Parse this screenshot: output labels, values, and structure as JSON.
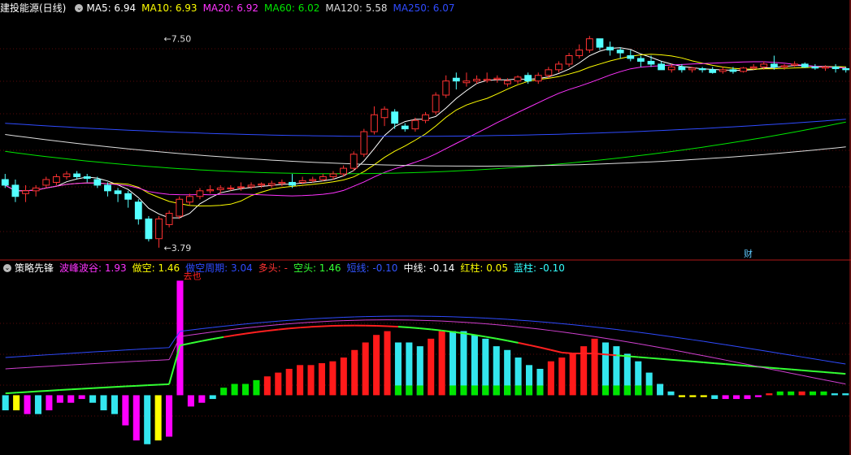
{
  "top_legend": {
    "stock": "建投能源(日线)",
    "ma5": "MA5: 6.94",
    "ma10": "MA10: 6.93",
    "ma20": "MA20: 6.92",
    "ma60": "MA60: 6.02",
    "ma120": "MA120: 5.58",
    "ma250": "MA250: 6.07",
    "colors": {
      "ma5": "#ffffff",
      "ma10": "#ffff00",
      "ma20": "#ff33ff",
      "ma60": "#00e600",
      "ma120": "#dddddd",
      "ma250": "#2f4bff"
    }
  },
  "bottom_legend": {
    "name": "策略先锋",
    "bofeng": "波峰波谷: 1.93",
    "zuokong": "做空: 1.46",
    "zuokong_period": "做空周期: 3.04",
    "duotou": "多头: -",
    "kongtou": "空头: 1.46",
    "duanxian": "短线: -0.10",
    "zhongxian": "中线: -0.14",
    "hongzhu": "红柱: 0.05",
    "lanzhu": "蓝柱: -0.10"
  },
  "cai_label": "财",
  "chart_data": [
    {
      "type": "candlestick",
      "title": "建投能源(日线)",
      "ylim": [
        3.6,
        7.9
      ],
      "annotations": [
        {
          "text": "7.50",
          "value": 7.5
        },
        {
          "text": "3.79",
          "value": 3.79
        }
      ],
      "candles": [
        [
          5.0,
          4.9,
          5.1,
          4.85
        ],
        [
          4.9,
          4.7,
          5.0,
          4.6
        ],
        [
          4.75,
          4.8,
          4.9,
          4.6
        ],
        [
          4.8,
          4.85,
          4.9,
          4.7
        ],
        [
          4.9,
          5.0,
          5.05,
          4.85
        ],
        [
          4.95,
          5.05,
          5.1,
          4.9
        ],
        [
          5.05,
          5.1,
          5.15,
          5.0
        ],
        [
          5.1,
          5.05,
          5.15,
          5.0
        ],
        [
          5.05,
          5.02,
          5.1,
          4.95
        ],
        [
          5.0,
          4.9,
          5.05,
          4.85
        ],
        [
          4.9,
          4.8,
          4.95,
          4.7
        ],
        [
          4.8,
          4.75,
          4.85,
          4.6
        ],
        [
          4.75,
          4.65,
          4.8,
          4.5
        ],
        [
          4.6,
          4.3,
          4.65,
          4.2
        ],
        [
          4.3,
          3.95,
          4.35,
          3.9
        ],
        [
          3.95,
          4.3,
          4.35,
          3.79
        ],
        [
          4.2,
          4.4,
          4.45,
          4.15
        ],
        [
          4.35,
          4.65,
          4.7,
          4.3
        ],
        [
          4.6,
          4.7,
          4.75,
          4.55
        ],
        [
          4.7,
          4.8,
          4.85,
          4.65
        ],
        [
          4.8,
          4.82,
          4.9,
          4.75
        ],
        [
          4.82,
          4.85,
          4.9,
          4.75
        ],
        [
          4.85,
          4.85,
          4.9,
          4.8
        ],
        [
          4.86,
          4.87,
          4.95,
          4.8
        ],
        [
          4.87,
          4.9,
          4.95,
          4.83
        ],
        [
          4.9,
          4.92,
          4.95,
          4.85
        ],
        [
          4.9,
          4.93,
          4.98,
          4.85
        ],
        [
          4.93,
          4.95,
          5.0,
          4.88
        ],
        [
          4.95,
          4.9,
          5.1,
          4.85
        ],
        [
          4.95,
          4.98,
          5.05,
          4.92
        ],
        [
          4.98,
          5.0,
          5.05,
          4.95
        ],
        [
          5.0,
          5.05,
          5.1,
          4.97
        ],
        [
          5.05,
          5.1,
          5.15,
          5.0
        ],
        [
          5.1,
          5.2,
          5.25,
          5.05
        ],
        [
          5.2,
          5.45,
          5.5,
          5.15
        ],
        [
          5.45,
          5.85,
          5.9,
          5.4
        ],
        [
          5.85,
          6.15,
          6.3,
          5.8
        ],
        [
          6.1,
          6.25,
          6.3,
          5.95
        ],
        [
          6.2,
          6.0,
          6.25,
          5.9
        ],
        [
          5.95,
          5.9,
          6.0,
          5.85
        ],
        [
          5.9,
          6.05,
          6.1,
          5.85
        ],
        [
          6.05,
          6.15,
          6.2,
          6.0
        ],
        [
          6.2,
          6.5,
          6.55,
          6.15
        ],
        [
          6.5,
          6.75,
          6.85,
          6.45
        ],
        [
          6.8,
          6.75,
          6.9,
          6.6
        ],
        [
          6.72,
          6.75,
          6.9,
          6.65
        ],
        [
          6.75,
          6.78,
          6.85,
          6.7
        ],
        [
          6.76,
          6.78,
          6.9,
          6.72
        ],
        [
          6.78,
          6.8,
          6.85,
          6.72
        ],
        [
          6.7,
          6.75,
          6.8,
          6.65
        ],
        [
          6.75,
          6.82,
          6.85,
          6.7
        ],
        [
          6.85,
          6.75,
          6.9,
          6.7
        ],
        [
          6.75,
          6.85,
          6.9,
          6.7
        ],
        [
          6.85,
          6.95,
          7.0,
          6.8
        ],
        [
          6.95,
          7.05,
          7.1,
          6.9
        ],
        [
          7.05,
          7.2,
          7.25,
          7.0
        ],
        [
          7.2,
          7.3,
          7.4,
          7.15
        ],
        [
          7.3,
          7.5,
          7.55,
          7.25
        ],
        [
          7.5,
          7.35,
          7.5,
          7.3
        ],
        [
          7.35,
          7.3,
          7.45,
          7.2
        ],
        [
          7.3,
          7.25,
          7.35,
          7.15
        ],
        [
          7.2,
          7.15,
          7.3,
          7.1
        ],
        [
          7.15,
          7.1,
          7.2,
          7.0
        ],
        [
          7.1,
          7.05,
          7.2,
          7.0
        ],
        [
          7.05,
          6.95,
          7.1,
          6.95
        ],
        [
          6.95,
          7.0,
          7.05,
          6.9
        ],
        [
          7.0,
          6.95,
          7.05,
          6.9
        ],
        [
          6.95,
          6.98,
          7.0,
          6.9
        ],
        [
          6.97,
          6.95,
          7.0,
          6.9
        ],
        [
          6.95,
          6.9,
          7.0,
          6.88
        ],
        [
          6.92,
          6.95,
          7.0,
          6.88
        ],
        [
          6.95,
          6.92,
          7.0,
          6.88
        ],
        [
          6.92,
          6.98,
          7.0,
          6.9
        ],
        [
          6.98,
          7.0,
          7.05,
          6.95
        ],
        [
          7.0,
          7.05,
          7.1,
          6.95
        ],
        [
          7.05,
          7.0,
          7.2,
          6.95
        ],
        [
          7.0,
          7.02,
          7.05,
          6.95
        ],
        [
          7.03,
          7.05,
          7.1,
          7.0
        ],
        [
          7.05,
          7.0,
          7.08,
          6.98
        ],
        [
          7.0,
          6.98,
          7.05,
          6.95
        ],
        [
          6.98,
          7.0,
          7.03,
          6.93
        ],
        [
          7.0,
          6.97,
          7.05,
          6.9
        ],
        [
          6.97,
          6.95,
          7.0,
          6.9
        ]
      ]
    },
    {
      "type": "bar",
      "title": "策略先锋",
      "ylim": [
        -1.5,
        3.2
      ],
      "annotations": [
        {
          "text": "去也",
          "index": 16
        }
      ],
      "histogram": [
        [
          -0.4,
          "cyan"
        ],
        [
          -0.4,
          "yellow"
        ],
        [
          -0.5,
          "magenta"
        ],
        [
          -0.5,
          "cyan"
        ],
        [
          -0.4,
          "magenta"
        ],
        [
          -0.2,
          "magenta"
        ],
        [
          -0.2,
          "magenta"
        ],
        [
          -0.1,
          "magenta"
        ],
        [
          -0.2,
          "cyan"
        ],
        [
          -0.4,
          "cyan"
        ],
        [
          -0.5,
          "cyan"
        ],
        [
          -0.8,
          "magenta"
        ],
        [
          -1.2,
          "magenta"
        ],
        [
          -1.3,
          "cyan"
        ],
        [
          -1.2,
          "yellow"
        ],
        [
          -1.1,
          "magenta"
        ],
        [
          3.04,
          "magenta"
        ],
        [
          -0.3,
          "magenta"
        ],
        [
          -0.2,
          "magenta"
        ],
        [
          -0.1,
          "cyan"
        ],
        [
          0.2,
          "green"
        ],
        [
          0.3,
          "green"
        ],
        [
          0.3,
          "green"
        ],
        [
          0.4,
          "green"
        ],
        [
          0.5,
          "red"
        ],
        [
          0.6,
          "red"
        ],
        [
          0.7,
          "red"
        ],
        [
          0.8,
          "red"
        ],
        [
          0.8,
          "red"
        ],
        [
          0.85,
          "red"
        ],
        [
          0.9,
          "red"
        ],
        [
          1.0,
          "red"
        ],
        [
          1.2,
          "red"
        ],
        [
          1.4,
          "red"
        ],
        [
          1.6,
          "red"
        ],
        [
          1.7,
          "red"
        ],
        [
          1.4,
          "cyan"
        ],
        [
          1.4,
          "cyan"
        ],
        [
          1.3,
          "cyan"
        ],
        [
          1.5,
          "red"
        ],
        [
          1.7,
          "red"
        ],
        [
          1.7,
          "cyan"
        ],
        [
          1.7,
          "cyan"
        ],
        [
          1.6,
          "cyan"
        ],
        [
          1.5,
          "cyan"
        ],
        [
          1.3,
          "cyan"
        ],
        [
          1.2,
          "cyan"
        ],
        [
          1.0,
          "cyan"
        ],
        [
          0.8,
          "cyan"
        ],
        [
          0.7,
          "cyan"
        ],
        [
          0.9,
          "red"
        ],
        [
          1.0,
          "red"
        ],
        [
          1.1,
          "red"
        ],
        [
          1.3,
          "red"
        ],
        [
          1.5,
          "red"
        ],
        [
          1.4,
          "cyan"
        ],
        [
          1.3,
          "cyan"
        ],
        [
          1.1,
          "cyan"
        ],
        [
          0.9,
          "cyan"
        ],
        [
          0.6,
          "cyan"
        ],
        [
          0.3,
          "cyan"
        ],
        [
          0.1,
          "cyan"
        ],
        [
          -0.05,
          "yellow"
        ],
        [
          -0.05,
          "yellow"
        ],
        [
          -0.05,
          "yellow"
        ],
        [
          -0.1,
          "cyan"
        ],
        [
          -0.1,
          "magenta"
        ],
        [
          -0.1,
          "magenta"
        ],
        [
          -0.1,
          "magenta"
        ],
        [
          -0.05,
          "magenta"
        ],
        [
          0.05,
          "red"
        ],
        [
          0.1,
          "green"
        ],
        [
          0.1,
          "green"
        ],
        [
          0.1,
          "red"
        ],
        [
          0.1,
          "green"
        ],
        [
          0.1,
          "green"
        ],
        [
          0.05,
          "cyan"
        ],
        [
          0.05,
          "cyan"
        ]
      ]
    }
  ]
}
